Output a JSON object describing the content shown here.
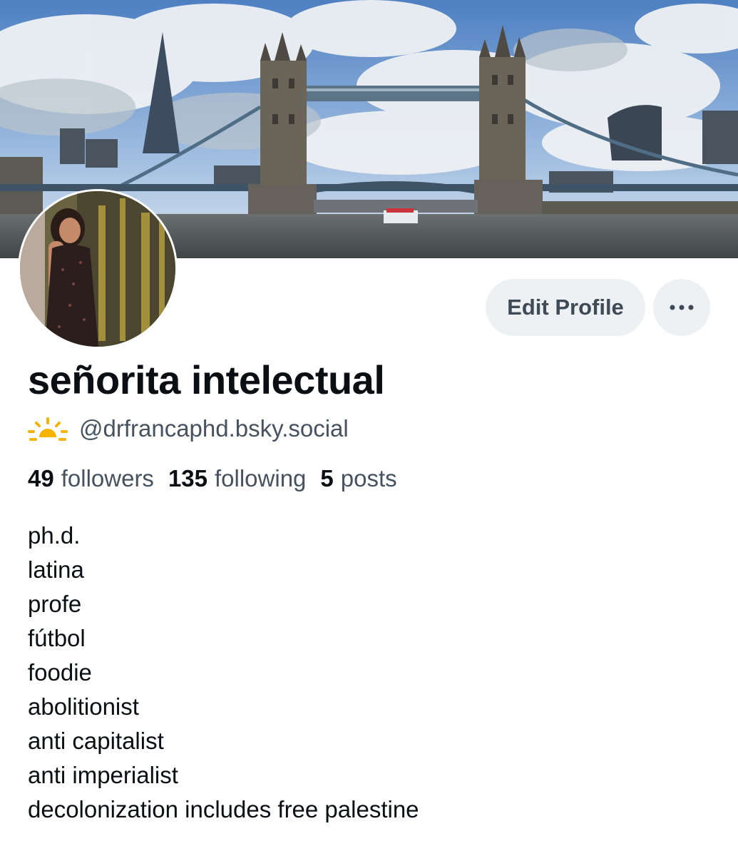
{
  "profile": {
    "display_name": "señorita intelectual",
    "handle": "@drfrancaphd.bsky.social",
    "edit_profile_label": "Edit Profile",
    "more_label": "•••"
  },
  "stats": [
    {
      "count": "49",
      "label": "followers"
    },
    {
      "count": "135",
      "label": "following"
    },
    {
      "count": "5",
      "label": "posts"
    }
  ],
  "bio_lines": [
    "ph.d.",
    "latina",
    "profe",
    "fútbol",
    "foodie",
    "abolitionist",
    "anti capitalist",
    "anti imperialist",
    "decolonization includes free palestine"
  ],
  "icons": {
    "handle_emoji": "sunrise-icon",
    "more": "ellipsis-icon"
  },
  "colors": {
    "button_bg": "#eef1f4",
    "secondary_text": "#46525f",
    "primary_text": "#0b0f14"
  }
}
